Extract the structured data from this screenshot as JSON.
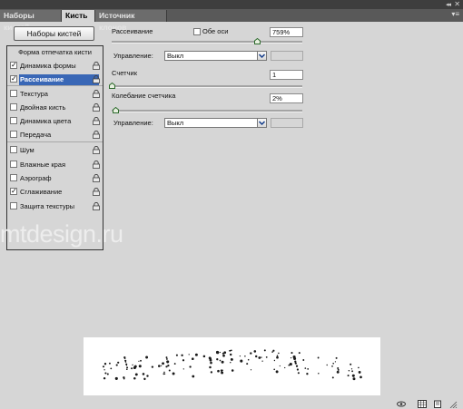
{
  "tabs": [
    {
      "label": "Наборы кистей",
      "active": false
    },
    {
      "label": "Кисть",
      "active": true
    },
    {
      "label": "Источник клонов",
      "active": false
    }
  ],
  "presets_button": "Наборы кистей",
  "watermark": "mtdesign.ru",
  "brush_list": {
    "header": "Форма отпечатка кисти",
    "items": [
      {
        "label": "Динамика формы",
        "checked": true,
        "selected": false
      },
      {
        "label": "Рассеивание",
        "checked": true,
        "selected": true
      },
      {
        "label": "Текстура",
        "checked": false,
        "selected": false
      },
      {
        "label": "Двойная кисть",
        "checked": false,
        "selected": false
      },
      {
        "label": "Динамика цвета",
        "checked": false,
        "selected": false
      },
      {
        "label": "Передача",
        "checked": false,
        "selected": false
      },
      {
        "label": "Шум",
        "checked": false,
        "selected": false
      },
      {
        "label": "Влажные края",
        "checked": false,
        "selected": false
      },
      {
        "label": "Аэрограф",
        "checked": false,
        "selected": false
      },
      {
        "label": "Сглаживание",
        "checked": true,
        "selected": false
      },
      {
        "label": "Защита текстуры",
        "checked": false,
        "selected": false
      }
    ]
  },
  "settings": {
    "scatter": {
      "label": "Рассеивание",
      "both_axes_label": "Обе оси",
      "both_axes_checked": false,
      "value": "759%",
      "level": 0.76
    },
    "control1": {
      "label": "Управление:",
      "value": "Выкл"
    },
    "count": {
      "label": "Счетчик",
      "value": "1",
      "level": 0.0
    },
    "count_jitter": {
      "label": "Колебание счетчика",
      "value": "2%",
      "level": 0.02
    },
    "control2": {
      "label": "Управление:",
      "value": "Выкл"
    }
  },
  "colors": {
    "selection": "#3967b6",
    "panel_bg": "#d6d6d6",
    "tab_bar": "#595959"
  }
}
